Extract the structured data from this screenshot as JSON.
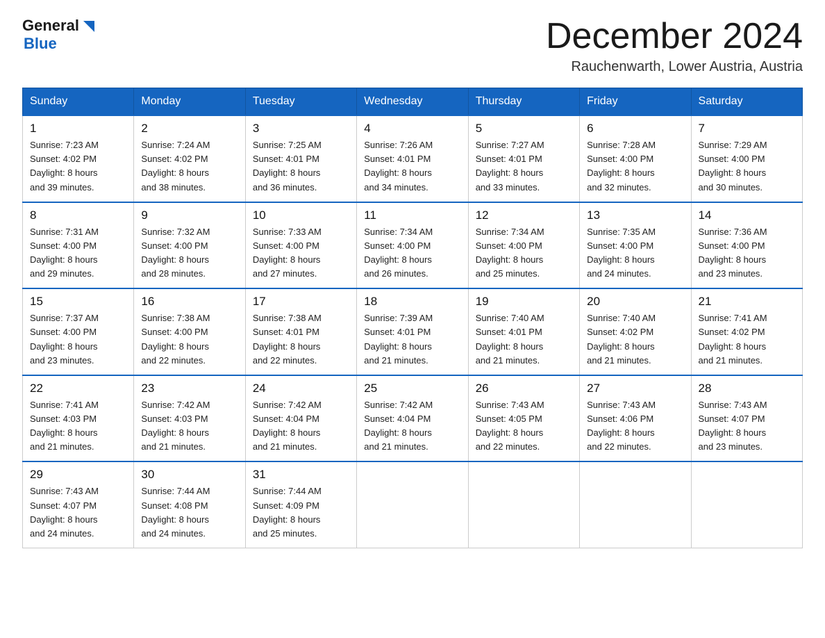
{
  "header": {
    "logo_general": "General",
    "logo_blue": "Blue",
    "main_title": "December 2024",
    "subtitle": "Rauchenwarth, Lower Austria, Austria"
  },
  "calendar": {
    "days_of_week": [
      "Sunday",
      "Monday",
      "Tuesday",
      "Wednesday",
      "Thursday",
      "Friday",
      "Saturday"
    ],
    "weeks": [
      [
        {
          "num": "1",
          "sunrise": "7:23 AM",
          "sunset": "4:02 PM",
          "daylight": "8 hours and 39 minutes."
        },
        {
          "num": "2",
          "sunrise": "7:24 AM",
          "sunset": "4:02 PM",
          "daylight": "8 hours and 38 minutes."
        },
        {
          "num": "3",
          "sunrise": "7:25 AM",
          "sunset": "4:01 PM",
          "daylight": "8 hours and 36 minutes."
        },
        {
          "num": "4",
          "sunrise": "7:26 AM",
          "sunset": "4:01 PM",
          "daylight": "8 hours and 34 minutes."
        },
        {
          "num": "5",
          "sunrise": "7:27 AM",
          "sunset": "4:01 PM",
          "daylight": "8 hours and 33 minutes."
        },
        {
          "num": "6",
          "sunrise": "7:28 AM",
          "sunset": "4:00 PM",
          "daylight": "8 hours and 32 minutes."
        },
        {
          "num": "7",
          "sunrise": "7:29 AM",
          "sunset": "4:00 PM",
          "daylight": "8 hours and 30 minutes."
        }
      ],
      [
        {
          "num": "8",
          "sunrise": "7:31 AM",
          "sunset": "4:00 PM",
          "daylight": "8 hours and 29 minutes."
        },
        {
          "num": "9",
          "sunrise": "7:32 AM",
          "sunset": "4:00 PM",
          "daylight": "8 hours and 28 minutes."
        },
        {
          "num": "10",
          "sunrise": "7:33 AM",
          "sunset": "4:00 PM",
          "daylight": "8 hours and 27 minutes."
        },
        {
          "num": "11",
          "sunrise": "7:34 AM",
          "sunset": "4:00 PM",
          "daylight": "8 hours and 26 minutes."
        },
        {
          "num": "12",
          "sunrise": "7:34 AM",
          "sunset": "4:00 PM",
          "daylight": "8 hours and 25 minutes."
        },
        {
          "num": "13",
          "sunrise": "7:35 AM",
          "sunset": "4:00 PM",
          "daylight": "8 hours and 24 minutes."
        },
        {
          "num": "14",
          "sunrise": "7:36 AM",
          "sunset": "4:00 PM",
          "daylight": "8 hours and 23 minutes."
        }
      ],
      [
        {
          "num": "15",
          "sunrise": "7:37 AM",
          "sunset": "4:00 PM",
          "daylight": "8 hours and 23 minutes."
        },
        {
          "num": "16",
          "sunrise": "7:38 AM",
          "sunset": "4:00 PM",
          "daylight": "8 hours and 22 minutes."
        },
        {
          "num": "17",
          "sunrise": "7:38 AM",
          "sunset": "4:01 PM",
          "daylight": "8 hours and 22 minutes."
        },
        {
          "num": "18",
          "sunrise": "7:39 AM",
          "sunset": "4:01 PM",
          "daylight": "8 hours and 21 minutes."
        },
        {
          "num": "19",
          "sunrise": "7:40 AM",
          "sunset": "4:01 PM",
          "daylight": "8 hours and 21 minutes."
        },
        {
          "num": "20",
          "sunrise": "7:40 AM",
          "sunset": "4:02 PM",
          "daylight": "8 hours and 21 minutes."
        },
        {
          "num": "21",
          "sunrise": "7:41 AM",
          "sunset": "4:02 PM",
          "daylight": "8 hours and 21 minutes."
        }
      ],
      [
        {
          "num": "22",
          "sunrise": "7:41 AM",
          "sunset": "4:03 PM",
          "daylight": "8 hours and 21 minutes."
        },
        {
          "num": "23",
          "sunrise": "7:42 AM",
          "sunset": "4:03 PM",
          "daylight": "8 hours and 21 minutes."
        },
        {
          "num": "24",
          "sunrise": "7:42 AM",
          "sunset": "4:04 PM",
          "daylight": "8 hours and 21 minutes."
        },
        {
          "num": "25",
          "sunrise": "7:42 AM",
          "sunset": "4:04 PM",
          "daylight": "8 hours and 21 minutes."
        },
        {
          "num": "26",
          "sunrise": "7:43 AM",
          "sunset": "4:05 PM",
          "daylight": "8 hours and 22 minutes."
        },
        {
          "num": "27",
          "sunrise": "7:43 AM",
          "sunset": "4:06 PM",
          "daylight": "8 hours and 22 minutes."
        },
        {
          "num": "28",
          "sunrise": "7:43 AM",
          "sunset": "4:07 PM",
          "daylight": "8 hours and 23 minutes."
        }
      ],
      [
        {
          "num": "29",
          "sunrise": "7:43 AM",
          "sunset": "4:07 PM",
          "daylight": "8 hours and 24 minutes."
        },
        {
          "num": "30",
          "sunrise": "7:44 AM",
          "sunset": "4:08 PM",
          "daylight": "8 hours and 24 minutes."
        },
        {
          "num": "31",
          "sunrise": "7:44 AM",
          "sunset": "4:09 PM",
          "daylight": "8 hours and 25 minutes."
        },
        null,
        null,
        null,
        null
      ]
    ],
    "labels": {
      "sunrise": "Sunrise: ",
      "sunset": "Sunset: ",
      "daylight": "Daylight: "
    }
  }
}
